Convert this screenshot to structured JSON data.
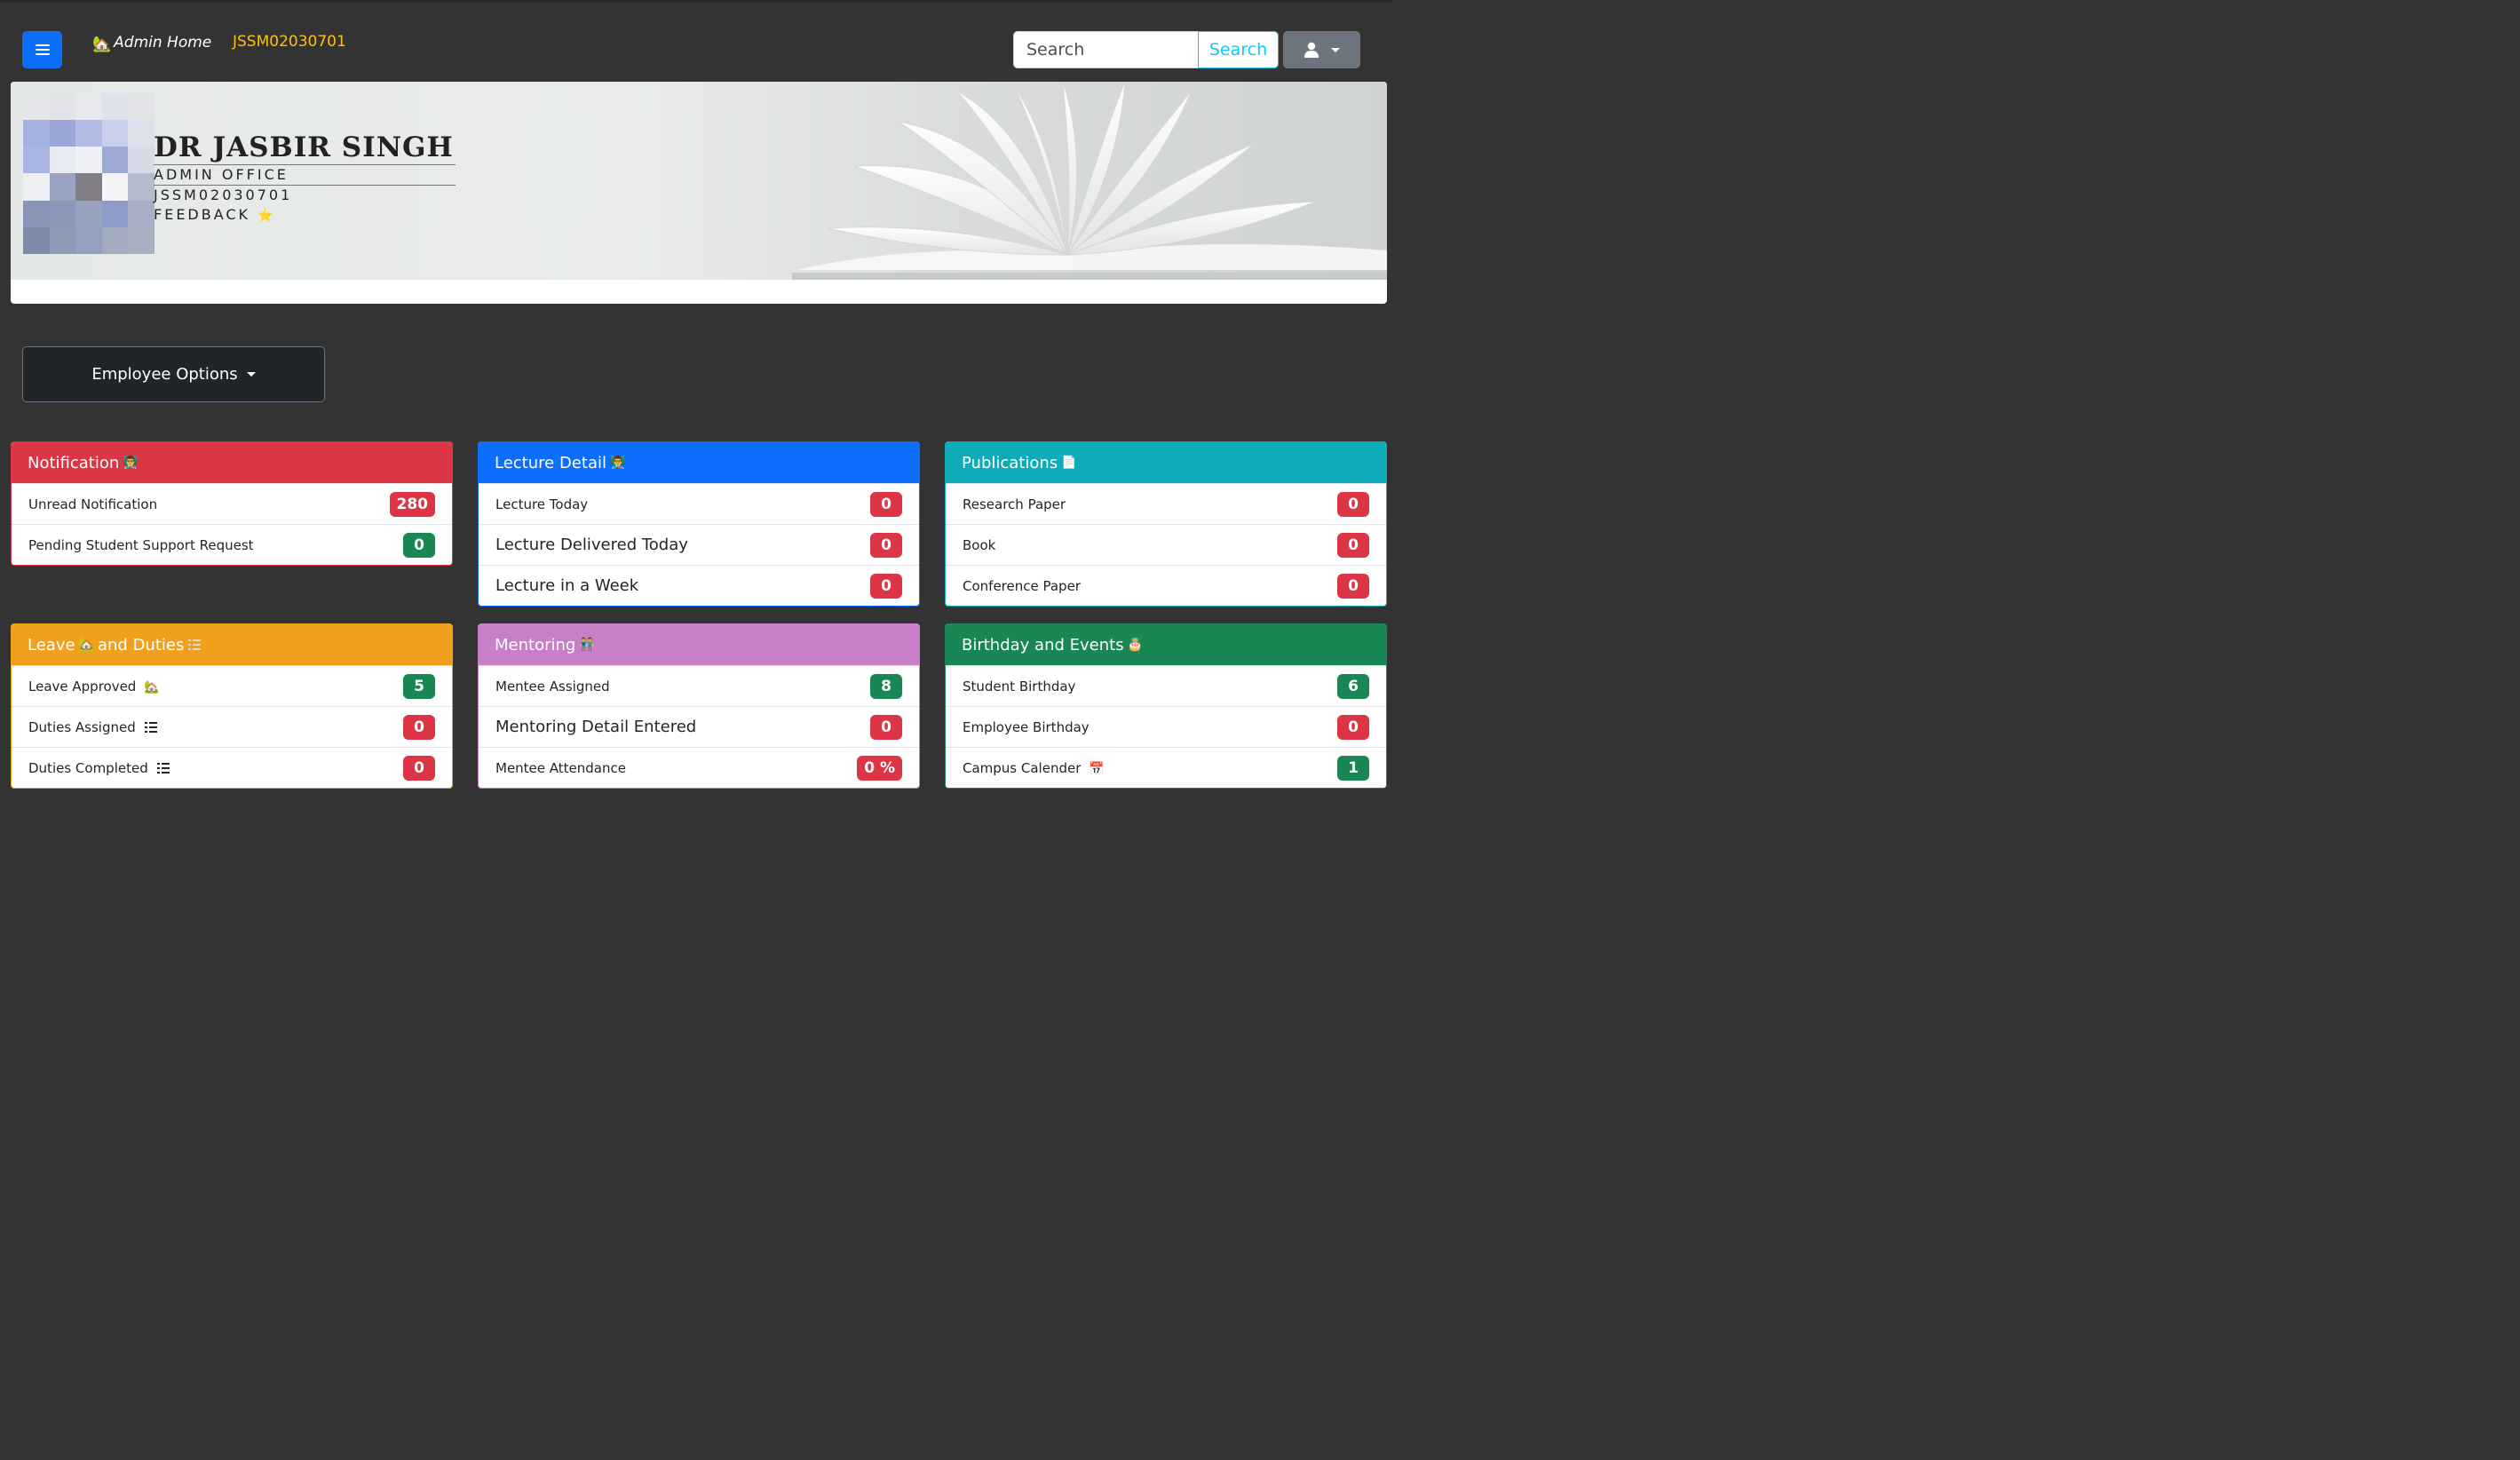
{
  "navbar": {
    "home_label": "Admin Home",
    "home_icon": "🏡",
    "employee_id": "JSSM02030701",
    "search_placeholder": "Search",
    "search_button": "Search"
  },
  "profile": {
    "name": "DR JASBIR SINGH",
    "department": "ADMIN OFFICE",
    "id": "JSSM02030701",
    "feedback_label": "FEEDBACK",
    "feedback_icon": "⭐"
  },
  "employee_options": {
    "label": "Employee Options"
  },
  "cards": {
    "notification": {
      "title": "Notification",
      "icon": "👨‍🏫",
      "color": "#dc3545",
      "rows": [
        {
          "label": "Unread Notification",
          "value": "280",
          "badge_color": "#dc3545"
        },
        {
          "label": "Pending Student Support Request",
          "value": "0",
          "badge_color": "#198754"
        }
      ]
    },
    "lecture": {
      "title": "Lecture Detail",
      "icon": "👨‍🏫",
      "color": "#0d6efd",
      "rows": [
        {
          "label": "Lecture Today",
          "value": "0",
          "badge_color": "#dc3545"
        },
        {
          "label": "Lecture Delivered Today",
          "value": "0",
          "badge_color": "#dc3545"
        },
        {
          "label": "Lecture in a Week",
          "value": "0",
          "badge_color": "#dc3545"
        }
      ]
    },
    "publications": {
      "title": "Publications",
      "icon": "📄",
      "color": "#0dacb8",
      "rows": [
        {
          "label": "Research Paper",
          "value": "0",
          "badge_color": "#dc3545"
        },
        {
          "label": "Book",
          "value": "0",
          "badge_color": "#dc3545"
        },
        {
          "label": "Conference Paper",
          "value": "0",
          "badge_color": "#dc3545"
        }
      ]
    },
    "leave": {
      "title_a": "Leave",
      "icon_a": "🏡",
      "title_b": "and Duties",
      "color": "#f0a01c",
      "rows": [
        {
          "label": "Leave Approved",
          "icon": "🏡",
          "value": "5",
          "badge_color": "#198754"
        },
        {
          "label": "Duties Assigned",
          "value": "0",
          "badge_color": "#dc3545"
        },
        {
          "label": "Duties Completed",
          "value": "0",
          "badge_color": "#dc3545"
        }
      ]
    },
    "mentoring": {
      "title": "Mentoring",
      "icon": "👬",
      "color": "#c77fc7",
      "rows": [
        {
          "label": "Mentee Assigned",
          "value": "8",
          "badge_color": "#198754"
        },
        {
          "label": "Mentoring Detail Entered",
          "value": "0",
          "badge_color": "#dc3545"
        },
        {
          "label": "Mentee Attendance",
          "value": "0 %",
          "badge_color": "#dc3545"
        }
      ]
    },
    "birthday": {
      "title": "Birthday and Events",
      "icon": "🎂",
      "color": "#198754",
      "rows": [
        {
          "label": "Student Birthday",
          "value": "6",
          "badge_color": "#198754"
        },
        {
          "label": "Employee Birthday",
          "value": "0",
          "badge_color": "#dc3545"
        },
        {
          "label": "Campus Calender",
          "icon": "📅",
          "value": "1",
          "badge_color": "#198754"
        }
      ]
    }
  }
}
